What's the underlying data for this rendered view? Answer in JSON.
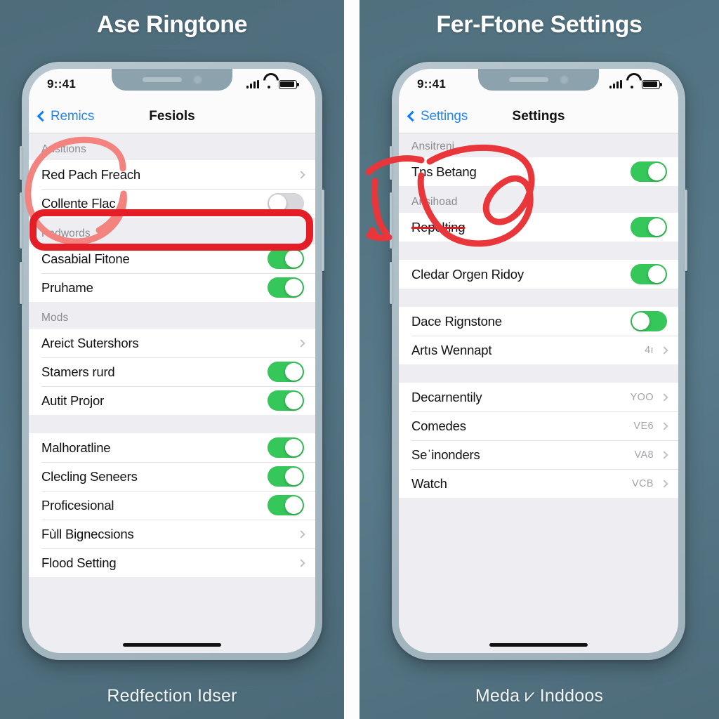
{
  "panels": {
    "left": {
      "title": "Ase Ringtone",
      "caption": "Redfection Idser",
      "status": {
        "time": "9::41"
      },
      "nav": {
        "back": "Remics",
        "title": "Fesiols"
      },
      "sections": [
        {
          "header": "Ansitions",
          "rows": [
            {
              "label": "Red Pach Freach",
              "control": "chevron"
            },
            {
              "label": "Collente Flac",
              "control": "toggle-off"
            }
          ]
        },
        {
          "header": "Padwords",
          "rows": [
            {
              "label": "Casabial Fitone",
              "control": "toggle-on"
            },
            {
              "label": "Pruhame",
              "control": "toggle-on"
            }
          ]
        },
        {
          "header": "Mods",
          "rows": [
            {
              "label": "Areict Sutershors",
              "control": "chevron"
            },
            {
              "label": "Stamers rurd",
              "control": "toggle-on"
            },
            {
              "label": "Autit Projor",
              "control": "toggle-on"
            }
          ]
        },
        {
          "header": "",
          "rows": [
            {
              "label": "Malhoratline",
              "control": "toggle-on"
            },
            {
              "label": "Clecling Seneers",
              "control": "toggle-on"
            },
            {
              "label": "Proficesional",
              "control": "toggle-on"
            },
            {
              "label": "Fùll Bignecsions",
              "control": "chevron"
            },
            {
              "label": "Flood Setting",
              "control": "chevron"
            }
          ]
        }
      ]
    },
    "right": {
      "title": "Fer-Ftone Settings",
      "caption": "Meda ⩗ Inddoos",
      "status": {
        "time": "9::41"
      },
      "nav": {
        "back": "Settings",
        "title": "Settings"
      },
      "sections": [
        {
          "header": "Ansitreni",
          "rows": [
            {
              "label": "Tns Betang",
              "control": "toggle-on"
            }
          ]
        },
        {
          "header": "Ansihoad",
          "rows": [
            {
              "label": "Repolting",
              "control": "toggle-on",
              "strike": true
            }
          ]
        },
        {
          "header": "",
          "rows": [
            {
              "label": "Cledar Orgen Ridoy",
              "control": "toggle-on"
            }
          ]
        },
        {
          "header": "",
          "rows": [
            {
              "label": "Dace Rignstone",
              "control": "toggle-on-knob-left"
            },
            {
              "label": "Artıs Wennapt",
              "control": "chevron",
              "value": "4ı"
            }
          ]
        },
        {
          "header": "",
          "rows": [
            {
              "label": "Decarnentily",
              "control": "chevron",
              "value": "YOO"
            },
            {
              "label": "Comedes",
              "control": "chevron",
              "value": "VE6"
            },
            {
              "label": "Seˈinonders",
              "control": "chevron",
              "value": "VA8"
            },
            {
              "label": "Watch",
              "control": "chevron",
              "value": "VCB"
            }
          ]
        }
      ]
    }
  },
  "icons": {
    "back_chevron": "chevron-left-icon",
    "row_chevron": "chevron-right-icon",
    "signal": "cellular-signal-icon",
    "wifi": "wifi-icon",
    "battery": "battery-icon"
  },
  "colors": {
    "background": "#4f6d7b",
    "accent_blue": "#2a86ec",
    "toggle_on": "#35c759",
    "toggle_off": "#d7d7dc",
    "annotation_red": "#e41e26",
    "annotation_pink": "#f2837f",
    "list_bg": "#eeeef2",
    "row_bg": "#ffffff"
  },
  "annotations": {
    "left_circle": "pink-circle-annotation",
    "left_rect": "red-rectangle-annotation",
    "right_loop": "red-loop-annotation",
    "right_strike": "red-strikethrough-annotation"
  }
}
